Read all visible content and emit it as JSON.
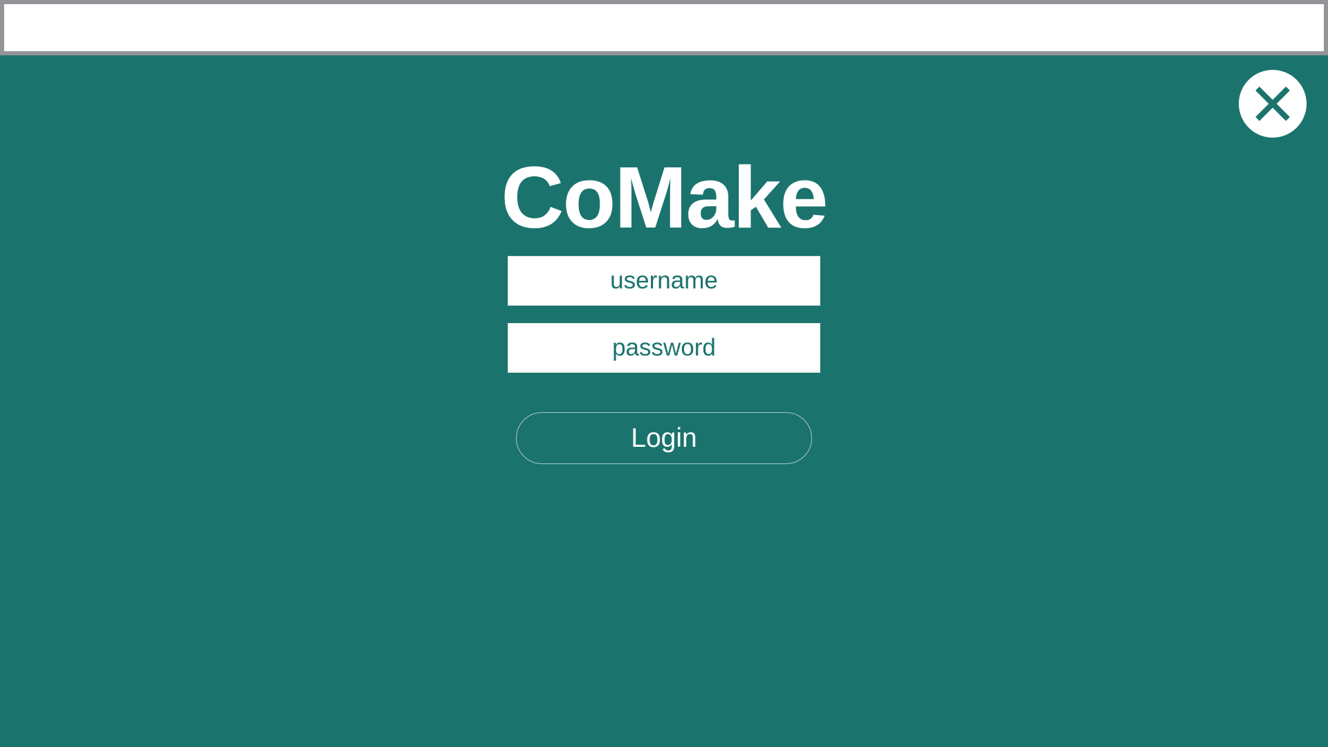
{
  "colors": {
    "background": "#1b736d",
    "topbar_border": "#939598",
    "surface": "#ffffff",
    "accent_text": "#1b736d"
  },
  "top_bar": {
    "value": ""
  },
  "close_button": {
    "icon": "close-icon"
  },
  "logo": {
    "text": "CoMake"
  },
  "login_form": {
    "username_placeholder": "username",
    "password_placeholder": "password",
    "login_label": "Login"
  }
}
